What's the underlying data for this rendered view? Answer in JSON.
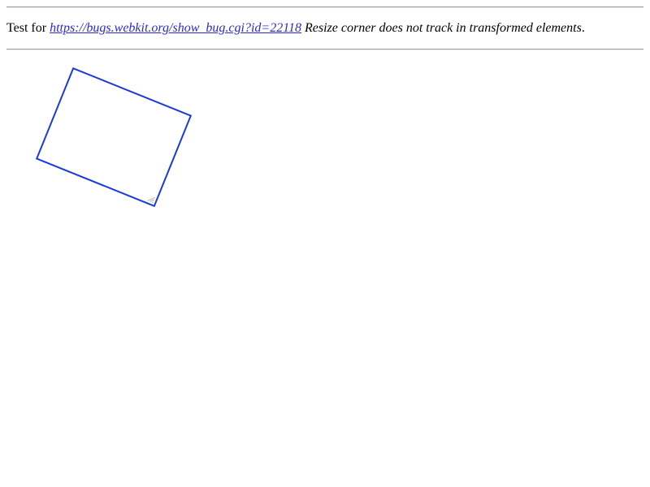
{
  "header": {
    "intro_text": "Test for",
    "link_text": "https://bugs.webkit.org/show_bug.cgi?id=22118",
    "description": "Resize corner does not track in transformed elements"
  },
  "colors": {
    "link": "#2a2ad6",
    "box_border": "#1a3ae0",
    "rule": "#9a9a9a"
  }
}
